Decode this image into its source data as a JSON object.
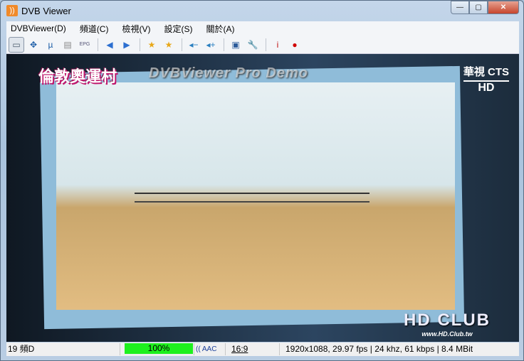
{
  "window": {
    "title": "DVB Viewer",
    "app_icon": "rss-icon",
    "minimize": "—",
    "maximize": "▢",
    "close": "✕"
  },
  "menu": [
    {
      "label": "DVBViewer(D)"
    },
    {
      "label": "頻道(C)"
    },
    {
      "label": "檢視(V)"
    },
    {
      "label": "設定(S)"
    },
    {
      "label": "關於(A)"
    }
  ],
  "toolbar": [
    {
      "icon": "window-mode-icon",
      "glyph": "▭",
      "color": "#4a5a6a"
    },
    {
      "icon": "fullscreen-icon",
      "glyph": "✥",
      "color": "#1e5fa8"
    },
    {
      "icon": "mini-mode-icon",
      "glyph": "µ",
      "color": "#1e5fa8"
    },
    {
      "icon": "osd-icon",
      "glyph": "▤",
      "color": "#888"
    },
    {
      "icon": "epg-icon",
      "glyph": "EPG",
      "color": "#557"
    },
    {
      "icon": "previous-channel-icon",
      "glyph": "◀",
      "color": "#2c6fd0"
    },
    {
      "icon": "next-channel-icon",
      "glyph": "▶",
      "color": "#2c6fd0"
    },
    {
      "icon": "favorite-prev-icon",
      "glyph": "★",
      "color": "#e8a81a"
    },
    {
      "icon": "favorite-next-icon",
      "glyph": "★",
      "color": "#e8a81a"
    },
    {
      "icon": "volume-down-icon",
      "glyph": "◂−",
      "color": "#2a7fc0"
    },
    {
      "icon": "volume-up-icon",
      "glyph": "◂+",
      "color": "#2a7fc0"
    },
    {
      "icon": "teletext-icon",
      "glyph": "▣",
      "color": "#2a5a9a"
    },
    {
      "icon": "settings-wrench-icon",
      "glyph": "🔧",
      "color": "#999"
    },
    {
      "icon": "info-icon",
      "glyph": "i",
      "color": "#c01010"
    },
    {
      "icon": "record-icon",
      "glyph": "●",
      "color": "#d00000"
    }
  ],
  "video": {
    "watermark": "DVBViewer Pro Demo",
    "channel_logo": "倫敦奧運村",
    "station_logo_top": "華視 CTS",
    "station_logo_hd": "HD",
    "club_logo": "HD CLUB",
    "club_url": "www.HD.Club.tw"
  },
  "status": {
    "channel": "19 頻D",
    "signal_percent": 100,
    "signal_label": "100%",
    "audio": "AAC",
    "aspect": "16:9",
    "stream_info": "1920x1088, 29.97 fps | 24 khz, 61 kbps | 8.4 MBit"
  }
}
